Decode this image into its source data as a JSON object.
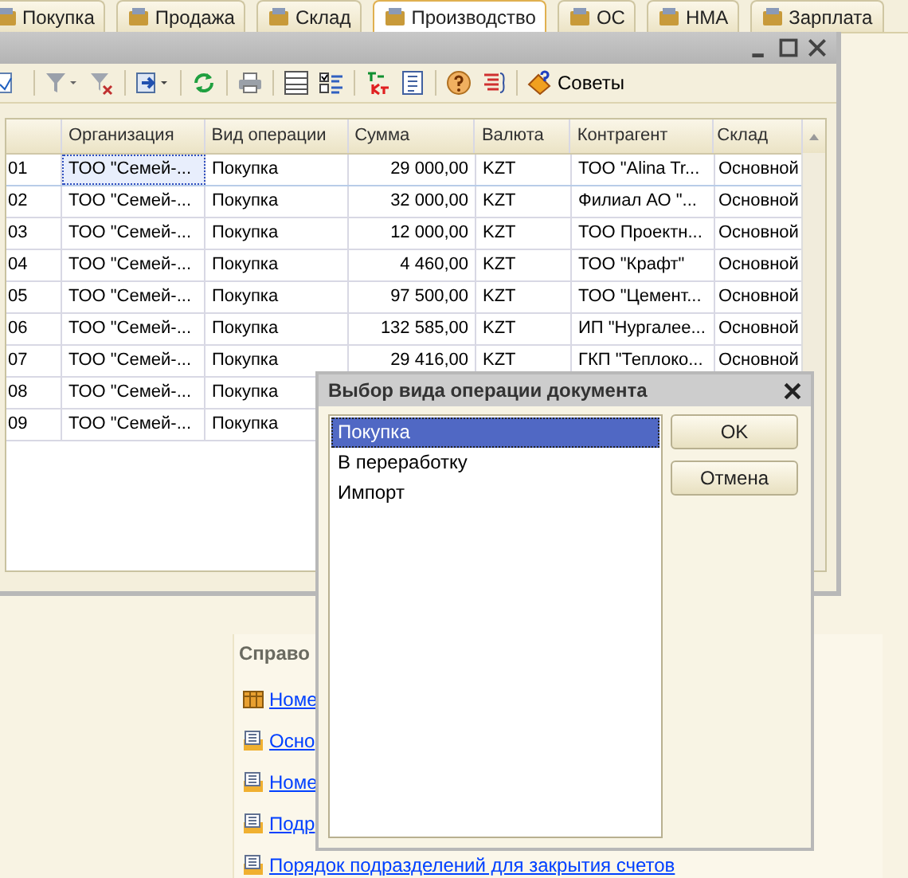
{
  "tabs": [
    {
      "label": "Покупка",
      "selected": false
    },
    {
      "label": "Продажа",
      "selected": false
    },
    {
      "label": "Склад",
      "selected": false
    },
    {
      "label": "Производство",
      "selected": true
    },
    {
      "label": "ОС",
      "selected": false
    },
    {
      "label": "НМА",
      "selected": false
    },
    {
      "label": "Зарплата",
      "selected": false
    }
  ],
  "window": {
    "toolbar": {
      "tips_button": "Советы"
    },
    "table": {
      "columns": [
        "Организация",
        "Вид операции",
        "Сумма",
        "Валюта",
        "Контрагент",
        "Склад"
      ],
      "rows": [
        {
          "number": "01",
          "organization": "ТОО \"Семей-...",
          "operation": "Покупка",
          "amount": "29 000,00",
          "currency": "KZT",
          "counterparty": "ТОО \"Alina Tr...",
          "warehouse": "Основной",
          "selected": true
        },
        {
          "number": "02",
          "organization": "ТОО \"Семей-...",
          "operation": "Покупка",
          "amount": "32 000,00",
          "currency": "KZT",
          "counterparty": "Филиал АО \"...",
          "warehouse": "Основной",
          "selected": false
        },
        {
          "number": "03",
          "organization": "ТОО \"Семей-...",
          "operation": "Покупка",
          "amount": "12 000,00",
          "currency": "KZT",
          "counterparty": "ТОО Проектн...",
          "warehouse": "Основной",
          "selected": false
        },
        {
          "number": "04",
          "organization": "ТОО \"Семей-...",
          "operation": "Покупка",
          "amount": "4 460,00",
          "currency": "KZT",
          "counterparty": "ТОО \"Крафт\"",
          "warehouse": "Основной",
          "selected": false
        },
        {
          "number": "05",
          "organization": "ТОО \"Семей-...",
          "operation": "Покупка",
          "amount": "97 500,00",
          "currency": "KZT",
          "counterparty": "ТОО \"Цемент...",
          "warehouse": "Основной",
          "selected": false
        },
        {
          "number": "06",
          "organization": "ТОО \"Семей-...",
          "operation": "Покупка",
          "amount": "132 585,00",
          "currency": "KZT",
          "counterparty": "ИП \"Нургалее...",
          "warehouse": "Основной",
          "selected": false
        },
        {
          "number": "07",
          "organization": "ТОО \"Семей-...",
          "operation": "Покупка",
          "amount": "29 416,00",
          "currency": "KZT",
          "counterparty": "ГКП \"Теплоко...",
          "warehouse": "Основной",
          "selected": false
        },
        {
          "number": "08",
          "organization": "ТОО \"Семей-...",
          "operation": "Покупка",
          "selected": false
        },
        {
          "number": "09",
          "organization": "ТОО \"Семей-...",
          "operation": "Покупка",
          "selected": false
        }
      ]
    }
  },
  "reference_panel": {
    "title": "Справо",
    "links": [
      {
        "label": "Номе",
        "kind": "table"
      },
      {
        "label": "Осно",
        "kind": "list"
      },
      {
        "label": "Номе",
        "kind": "list"
      },
      {
        "label": "Подр",
        "kind": "list"
      },
      {
        "label": "Порядок подразделений для закрытия счетов",
        "kind": "list"
      }
    ]
  },
  "dialog": {
    "title": "Выбор вида операции документа",
    "options": [
      {
        "label": "Покупка",
        "selected": true
      },
      {
        "label": "В переработку",
        "selected": false
      },
      {
        "label": "Импорт",
        "selected": false
      }
    ],
    "buttons": [
      "OK",
      "Отмена"
    ]
  }
}
